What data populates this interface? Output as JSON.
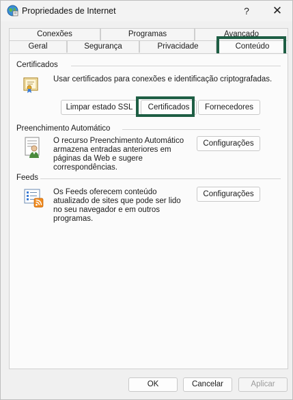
{
  "window": {
    "title": "Propriedades de Internet"
  },
  "titlebar": {
    "help_label": "?",
    "close_label": "✕"
  },
  "tabs": {
    "back_row": [
      "Conexões",
      "Programas",
      "Avançado"
    ],
    "front_row": [
      "Geral",
      "Segurança",
      "Privacidade",
      "Conteúdo"
    ],
    "active": "Conteúdo"
  },
  "certificates": {
    "title": "Certificados",
    "description": "Usar certificados para conexões e identificação criptografadas.",
    "clear_ssl_label": "Limpar estado SSL",
    "certificates_label": "Certificados",
    "publishers_label": "Fornecedores"
  },
  "autocomplete": {
    "title": "Preenchimento Automático",
    "description_lines": [
      "O recurso Preenchimento Automático",
      "armazena entradas anteriores em",
      "páginas da Web e sugere",
      "correspondências."
    ],
    "settings_label": "Configurações"
  },
  "feeds": {
    "title": "Feeds",
    "description_lines": [
      "Os Feeds oferecem conteúdo",
      "atualizado de sites que pode ser lido",
      "no seu navegador e em outros",
      "programas."
    ],
    "settings_label": "Configurações"
  },
  "footer": {
    "ok_label": "OK",
    "cancel_label": "Cancelar",
    "apply_label": "Aplicar"
  },
  "colors": {
    "highlight": "#1e5e44",
    "background": "#f0f0f0",
    "panel": "#fbfbfb"
  },
  "icons": {
    "app": "internet-options-globe-icon",
    "certificate": "certificate-icon",
    "autocomplete": "autocomplete-user-form-icon",
    "feeds": "rss-feeds-icon"
  }
}
